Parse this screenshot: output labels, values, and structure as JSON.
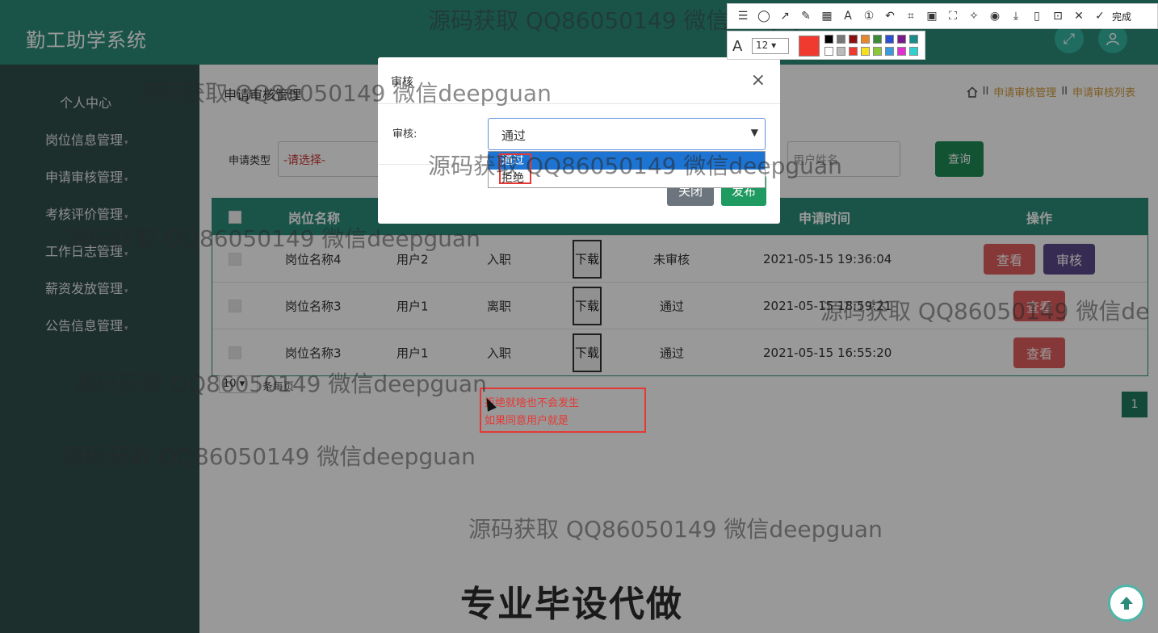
{
  "app": {
    "title": "勤工助学系统"
  },
  "sidebar": {
    "items": [
      {
        "label": "个人中心"
      },
      {
        "label": "岗位信息管理"
      },
      {
        "label": "申请审核管理"
      },
      {
        "label": "考核评价管理"
      },
      {
        "label": "工作日志管理"
      },
      {
        "label": "薪资发放管理"
      },
      {
        "label": "公告信息管理"
      }
    ]
  },
  "page": {
    "heading": "申请审核管理",
    "breadcrumb": [
      "申请审核管理",
      "申请审核列表"
    ],
    "breadcrumb_sep": "II"
  },
  "search": {
    "type_label": "申请类型",
    "type_placeholder": "-请选择-",
    "user_placeholder": "用户姓名",
    "query_label": "查询"
  },
  "table": {
    "headers": [
      "岗位名称",
      "申请时间",
      "操作"
    ],
    "rows": [
      {
        "job": "岗位名称4",
        "user": "用户2",
        "type": "入职",
        "file": "下载",
        "status": "未审核",
        "time": "2021-05-15 19:36:04",
        "actions": [
          "查看",
          "审核"
        ]
      },
      {
        "job": "岗位名称3",
        "user": "用户1",
        "type": "离职",
        "file": "下载",
        "status": "通过",
        "time": "2021-05-15 18:59:21",
        "actions": [
          "查看"
        ]
      },
      {
        "job": "岗位名称3",
        "user": "用户1",
        "type": "入职",
        "file": "下载",
        "status": "通过",
        "time": "2021-05-15 16:55:20",
        "actions": [
          "查看"
        ]
      }
    ]
  },
  "pager": {
    "page_size": "10",
    "page_size_suffix": "条每页",
    "current_page": "1"
  },
  "modal": {
    "title": "审核",
    "field_label": "审核:",
    "selected": "通过",
    "options": [
      "通过",
      "拒绝"
    ],
    "close_label": "关闭",
    "publish_label": "发布"
  },
  "annotation": {
    "line1": "拒绝就啥也不会发生",
    "line2": "如果同意用户就是"
  },
  "watermarks": {
    "text": "源码获取 QQ86050149 微信deepguan",
    "text_cut": "源码获取 QQ86050149 微信de",
    "banner": "专业毕设代做"
  },
  "screenshot_toolbar": {
    "done_label": "完成",
    "font_size": "12",
    "current_color": "#f03a30"
  }
}
